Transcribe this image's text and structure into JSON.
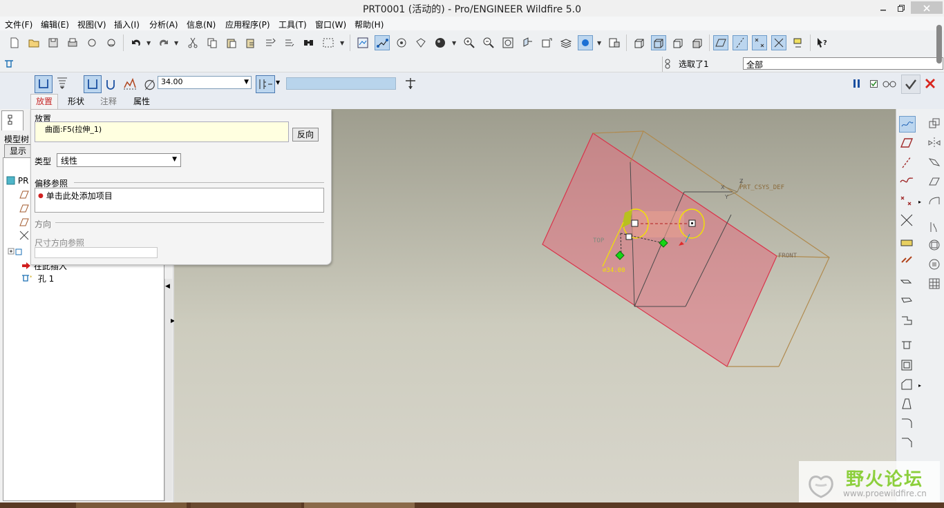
{
  "window": {
    "title": "PRT0001 (活动的) - Pro/ENGINEER Wildfire 5.0"
  },
  "menu": [
    "文件(F)",
    "编辑(E)",
    "视图(V)",
    "插入(I)",
    "分析(A)",
    "信息(N)",
    "应用程序(P)",
    "工具(T)",
    "窗口(W)",
    "帮助(H)"
  ],
  "selection": {
    "status": "选取了1",
    "filter": "全部"
  },
  "dashboard": {
    "diameter_symbol": "∅",
    "diameter_value": "34.00",
    "tabs": [
      "放置",
      "形状",
      "注释",
      "属性"
    ],
    "active_tab": "放置"
  },
  "placement_panel": {
    "placement_label": "放置",
    "placement_value": "曲面:F5(拉伸_1)",
    "flip_button": "反向",
    "type_label": "类型",
    "type_value": "线性",
    "offset_refs_label": "偏移参照",
    "offset_refs_hint": "单击此处添加项目",
    "direction_label": "方向",
    "dim_dir_label": "尺寸方向参照"
  },
  "model_tree": {
    "tab_label": "模型树",
    "show_button": "显示",
    "root": "PR",
    "insert_here": "在此插入",
    "hole_item": "孔 1"
  },
  "graphics": {
    "labels": {
      "csys": "PRT_CSYS_DEF",
      "front": "FRONT",
      "top": "TOP",
      "dim": "∅34.00",
      "z": "Z",
      "y": "Y",
      "x": "X"
    },
    "colors": {
      "surface": "#e0707f",
      "datum": "#b08a4e",
      "preview": "#f2e400",
      "handle_green": "#16d616"
    }
  },
  "watermark": {
    "name": "野火论坛",
    "url": "www.proewildfire.cn"
  }
}
